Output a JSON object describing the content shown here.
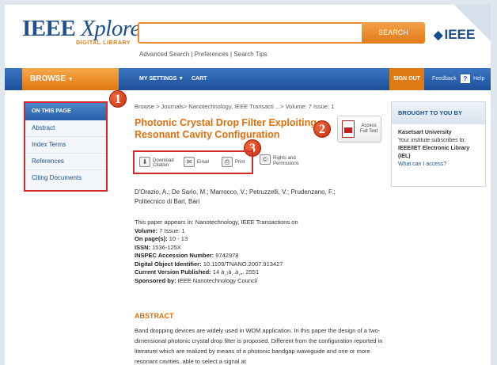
{
  "header": {
    "logo": "IEEE",
    "logo_italic": "Xplore",
    "logo_reg": "®",
    "logo_sub": "DIGITAL LIBRARY",
    "search_value": "",
    "search_button": "SEARCH",
    "links": "Advanced Search | Preferences | Search Tips",
    "brand_mark": "◆",
    "brand": "IEEE"
  },
  "nav": {
    "browse": "BROWSE",
    "browse_arrow": "▼",
    "my_settings": "MY SETTINGS ▼",
    "cart": "CART",
    "sign_out": "SIGN OUT",
    "feedback": "Feedback",
    "help_mark": "?",
    "help": "Help"
  },
  "sidebar": {
    "title": "ON THIS PAGE",
    "items": [
      {
        "label": "Abstract"
      },
      {
        "label": "Index Terms"
      },
      {
        "label": "References"
      },
      {
        "label": "Citing Documents"
      }
    ]
  },
  "markers": {
    "one": "1",
    "two": "2",
    "three": "3"
  },
  "article": {
    "breadcrumb": "Browse > Journals> Nanotechnology, IEEE Transacti ...> Volume: 7 Issue: 1",
    "title": "Photonic Crystal Drop Filter Exploiting Resonant Cavity Configuration",
    "access": "Access Full Text",
    "tools": {
      "download_citation": "Download Citation",
      "email": "Email",
      "print": "Print",
      "rights": "Rights and Permissions"
    },
    "authors": "D'Orazio, A.; De Sario, M.; Marrocco, V.; Petruzzelli, V.; Prudenzano, F.;",
    "affiliation": "Politecnico di Bari, Bari",
    "appears_in": "This paper appears in: Nanotechnology, IEEE Transactions on",
    "volume_label": "Volume:",
    "volume_value": "7 Issue: 1",
    "pages_label": "On page(s):",
    "pages_value": "10 - 13",
    "issn_label": "ISSN:",
    "issn_value": "1536-125X",
    "inspec_label": "INSPEC Accession Number:",
    "inspec_value": "9742978",
    "doi_label": "Digital Object Identifier:",
    "doi_value": "10.1109/TNANO.2007.913427",
    "cvp_label": "Current Version Published:",
    "cvp_value": "14 à¸¡à¸.à¸„. 2551",
    "sponsor_label": "Sponsored by:",
    "sponsor_value": "IEEE Nanotechnology Council",
    "abstract_heading": "ABSTRACT",
    "abstract_text": "Band dropping devices are widely used in WDM application. In this paper the design of a two-dimensional photonic crystal drop filter is proposed. Different from the configuration reported in literature which are realized by means of a photonic bandgap waveguide and one or more resonant cavities, able to select a signal at"
  },
  "brought": {
    "title": "BROUGHT TO YOU BY",
    "institution": "Kasetsart University",
    "subscribes": "Your institute subscribes to:",
    "library": "IEEE/IET Electronic Library (IEL)",
    "what": "What can I access?"
  },
  "icons": {
    "download": "⬇",
    "email": "✉",
    "print": "⎙",
    "rights": "©"
  }
}
